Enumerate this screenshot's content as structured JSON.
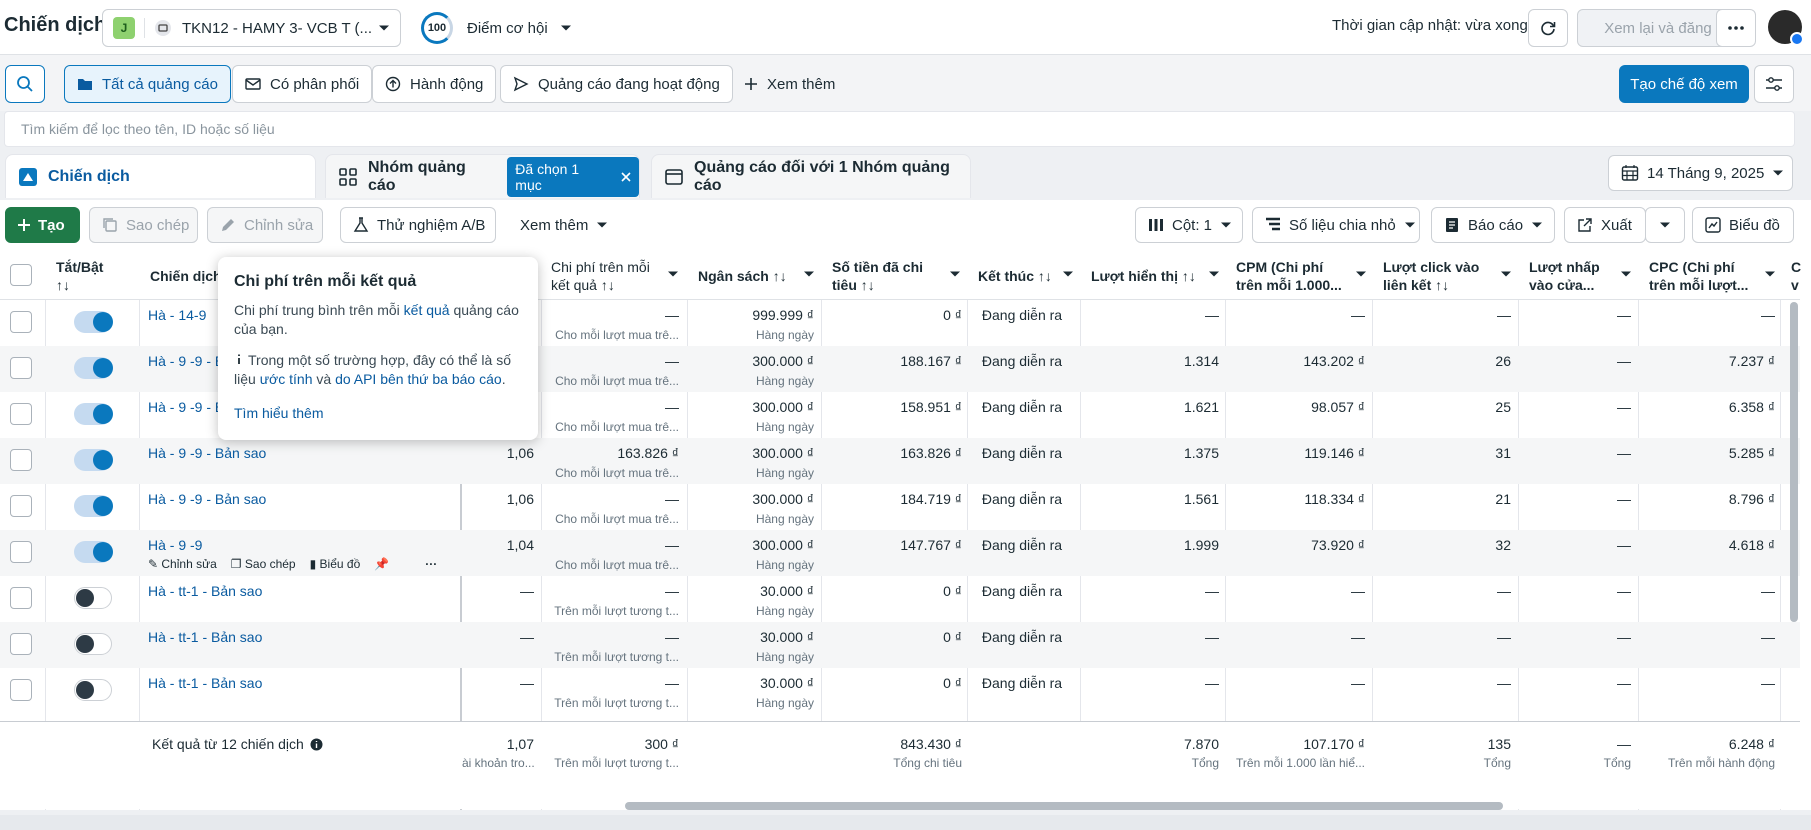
{
  "topbar": {
    "title": "Chiến dịch",
    "account_badge": "J",
    "account_name": "TKN12 - HAMY 3- VCB T (...",
    "opportunity_score": "100",
    "opportunity_label": "Điểm cơ hội",
    "updated_text": "Thời gian cập nhật: vừa xong",
    "review_label": "Xem lại và đăng"
  },
  "filters": {
    "all_ads": "Tất cả quảng cáo",
    "delivery": "Có phân phối",
    "actions": "Hành động",
    "active_ads": "Quảng cáo đang hoạt động",
    "see_more": "Xem thêm",
    "create_view": "Tạo chế độ xem"
  },
  "search": {
    "placeholder": "Tìm kiếm để lọc theo tên, ID hoặc số liệu"
  },
  "tabs": {
    "campaigns": "Chiến dịch",
    "adsets": "Nhóm quảng cáo",
    "selected_chip": "Đã chọn 1 mục",
    "ads": "Quảng cáo đối với 1 Nhóm quảng cáo",
    "date": "14 Tháng 9, 2025"
  },
  "actions": {
    "create": "Tạo",
    "duplicate": "Sao chép",
    "edit": "Chỉnh sửa",
    "ab_test": "Thử nghiệm A/B",
    "see_more": "Xem thêm",
    "columns": "Cột: 1",
    "breakdown": "Số liệu chia nhỏ",
    "reports": "Báo cáo",
    "export": "Xuất",
    "charts": "Biểu đồ"
  },
  "columns": {
    "toggle": "Tắt/Bật",
    "toggle_sort": "↑↓",
    "name": "Chiến dịch",
    "cpr_1": "Chi phí trên mỗi",
    "cpr_2": "kết quả ↑↓",
    "budget": "Ngân sách ↑↓",
    "spent_1": "Số tiền đã chi",
    "spent_2": "tiêu ↑↓",
    "end": "Kết thúc ↑↓",
    "impressions": "Lượt hiển thị ↑↓",
    "cpm_1": "CPM (Chi phí",
    "cpm_2": "trên mỗi 1.000...",
    "clicks_1": "Lượt click vào",
    "clicks_2": "liên kết ↑↓",
    "enter_1": "Lượt nhấp",
    "enter_2": "vào cửa...",
    "cpc_1": "CPC (Chi phí",
    "cpc_2": "trên mỗi lượt...",
    "last_1": "C",
    "last_2": "v"
  },
  "rows": [
    {
      "name": "Hà - 14-9",
      "on": true,
      "freq": "",
      "cpr": "—",
      "cpr_sub": "Cho mỗi lượt mua trê...",
      "budget": "999.999 ₫",
      "budget_sub": "Hàng ngày",
      "spent": "0 ₫",
      "end": "Đang diễn ra",
      "impr": "—",
      "cpm": "—",
      "clicks": "—",
      "enter": "—",
      "cpc": "—"
    },
    {
      "name": "Hà - 9 -9 - B",
      "on": true,
      "freq": "",
      "cpr": "—",
      "cpr_sub": "Cho mỗi lượt mua trê...",
      "budget": "300.000 ₫",
      "budget_sub": "Hàng ngày",
      "spent": "188.167 ₫",
      "end": "Đang diễn ra",
      "impr": "1.314",
      "cpm": "143.202 ₫",
      "clicks": "26",
      "enter": "—",
      "cpc": "7.237 ₫"
    },
    {
      "name": "Hà - 9 -9 - B",
      "on": true,
      "freq": "",
      "cpr": "—",
      "cpr_sub": "Cho mỗi lượt mua trê...",
      "budget": "300.000 ₫",
      "budget_sub": "Hàng ngày",
      "spent": "158.951 ₫",
      "end": "Đang diễn ra",
      "impr": "1.621",
      "cpm": "98.057 ₫",
      "clicks": "25",
      "enter": "—",
      "cpc": "6.358 ₫"
    },
    {
      "name": "Hà - 9 -9 - Bản sao",
      "on": true,
      "freq": "1,06",
      "cpr": "163.826 ₫",
      "cpr_sub": "Cho mỗi lượt mua trê...",
      "budget": "300.000 ₫",
      "budget_sub": "Hàng ngày",
      "spent": "163.826 ₫",
      "end": "Đang diễn ra",
      "impr": "1.375",
      "cpm": "119.146 ₫",
      "clicks": "31",
      "enter": "—",
      "cpc": "5.285 ₫"
    },
    {
      "name": "Hà - 9 -9 - Bản sao",
      "on": true,
      "freq": "1,06",
      "cpr": "—",
      "cpr_sub": "Cho mỗi lượt mua trê...",
      "budget": "300.000 ₫",
      "budget_sub": "Hàng ngày",
      "spent": "184.719 ₫",
      "end": "Đang diễn ra",
      "impr": "1.561",
      "cpm": "118.334 ₫",
      "clicks": "21",
      "enter": "—",
      "cpc": "8.796 ₫"
    },
    {
      "name": "Hà - 9 -9",
      "on": true,
      "freq": "1,04",
      "cpr": "—",
      "cpr_sub": "Cho mỗi lượt mua trê...",
      "budget": "300.000 ₫",
      "budget_sub": "Hàng ngày",
      "spent": "147.767 ₫",
      "end": "Đang diễn ra",
      "impr": "1.999",
      "cpm": "73.920 ₫",
      "clicks": "32",
      "enter": "—",
      "cpc": "4.618 ₫"
    },
    {
      "name": "Hà - tt-1 - Bản sao",
      "on": false,
      "freq": "—",
      "cpr": "—",
      "cpr_sub": "Trên mỗi lượt tương t...",
      "budget": "30.000 ₫",
      "budget_sub": "Hàng ngày",
      "spent": "0 ₫",
      "end": "Đang diễn ra",
      "impr": "—",
      "cpm": "—",
      "clicks": "—",
      "enter": "—",
      "cpc": "—"
    },
    {
      "name": "Hà - tt-1 - Bản sao",
      "on": false,
      "freq": "—",
      "cpr": "—",
      "cpr_sub": "Trên mỗi lượt tương t...",
      "budget": "30.000 ₫",
      "budget_sub": "Hàng ngày",
      "spent": "0 ₫",
      "end": "Đang diễn ra",
      "impr": "—",
      "cpm": "—",
      "clicks": "—",
      "enter": "—",
      "cpc": "—"
    },
    {
      "name": "Hà - tt-1 - Bản sao",
      "on": false,
      "freq": "—",
      "cpr": "—",
      "cpr_sub": "Trên mỗi lượt tương t...",
      "budget": "30.000 ₫",
      "budget_sub": "Hàng ngày",
      "spent": "0 ₫",
      "end": "Đang diễn ra",
      "impr": "—",
      "cpm": "—",
      "clicks": "—",
      "enter": "—",
      "cpc": "—"
    }
  ],
  "row_actions": {
    "edit": "Chỉnh sửa",
    "duplicate": "Sao chép",
    "chart": "Biểu đồ",
    "more": "···"
  },
  "summary": {
    "label": "Kết quả từ 12 chiến dịch",
    "freq": "1,07",
    "freq_sub": "ài khoản tro...",
    "cpr": "300 ₫",
    "cpr_sub": "Trên mỗi lượt tương t...",
    "spent": "843.430 ₫",
    "spent_sub": "Tổng chi tiêu",
    "impr": "7.870",
    "impr_sub": "Tổng",
    "cpm": "107.170 ₫",
    "cpm_sub": "Trên mỗi 1.000 lần hiể...",
    "clicks": "135",
    "clicks_sub": "Tổng",
    "enter": "—",
    "enter_sub": "Tổng",
    "cpc": "6.248 ₫",
    "cpc_sub": "Trên mỗi hành động"
  },
  "tooltip": {
    "title": "Chi phí trên mỗi kết quả",
    "desc_1": "Chi phí trung bình trên mỗi ",
    "desc_link": "kết quả",
    "desc_2": " quảng cáo của bạn.",
    "note_1": "Trong một số trường hợp, đây có thể là số liệu ",
    "note_link_1": "ước tính",
    "note_2": " và ",
    "note_link_2": "do API bên thứ ba báo cáo",
    "note_3": ".",
    "learn_more": "Tìm hiểu thêm"
  },
  "colors": {
    "primary": "#0a78be",
    "create_green": "#1f7a48",
    "link": "#0a5ba0"
  }
}
